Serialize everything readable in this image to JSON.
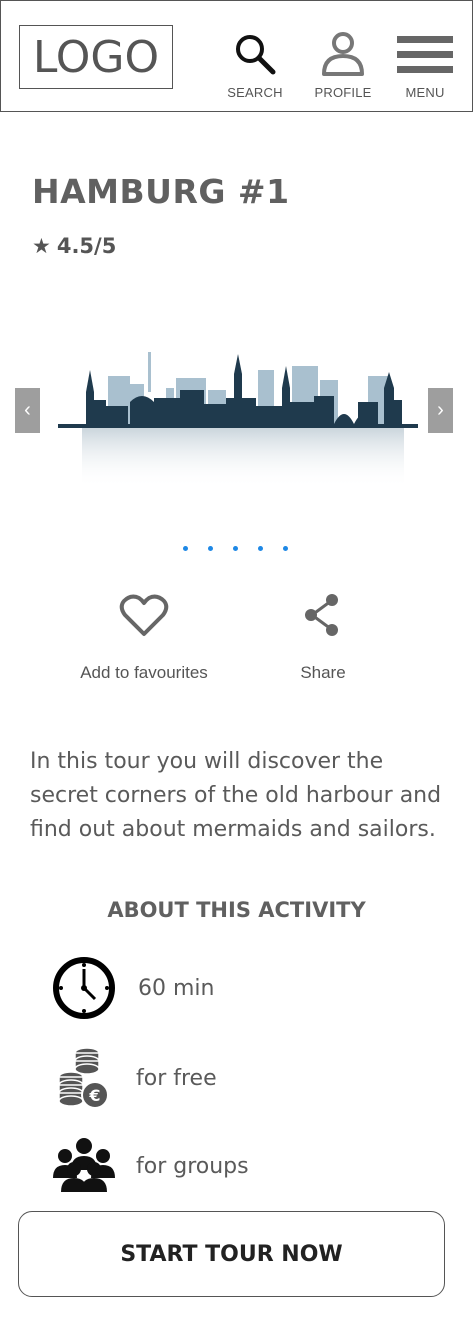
{
  "header": {
    "logo_text": "LOGO",
    "nav": {
      "search_label": "SEARCH",
      "profile_label": "PROFILE",
      "menu_label": "MENU"
    }
  },
  "tour": {
    "title": "HAMBURG #1",
    "rating_star": "★",
    "rating": "4.5/5",
    "carousel": {
      "prev_symbol": "‹",
      "next_symbol": "›",
      "slide_count": 5,
      "image_icon": "hamburg-skyline-image"
    },
    "actions": {
      "favourite_label": "Add to favourites",
      "favourite_icon": "heart-icon",
      "share_label": "Share",
      "share_icon": "share-icon"
    },
    "description": "In this tour you will discover the secret corners of the old harbour and find out about mermaids and sailors."
  },
  "about": {
    "heading": "ABOUT THIS ACTIVITY",
    "items": [
      {
        "icon": "clock-icon",
        "text": "60 min"
      },
      {
        "icon": "coins-euro-icon",
        "text": "for free"
      },
      {
        "icon": "group-icon",
        "text": "for groups"
      }
    ]
  },
  "cta": {
    "start_label": "START TOUR NOW"
  },
  "colors": {
    "border": "#555555",
    "text": "#555555",
    "dot_active": "#1e88e5",
    "arrow_bg": "#9e9e9e",
    "skyline_dark": "#1f3a4d",
    "skyline_light": "#9fb8c8"
  }
}
